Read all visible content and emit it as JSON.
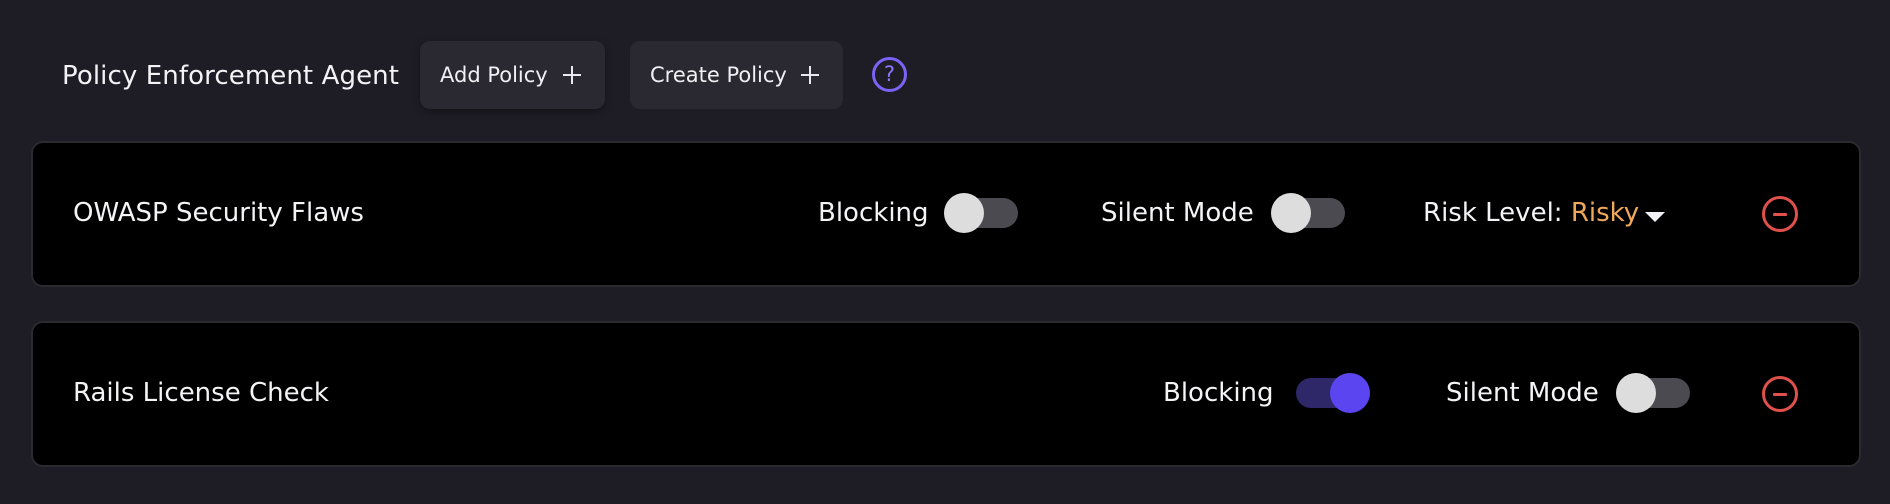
{
  "header": {
    "title": "Policy Enforcement Agent",
    "add_policy_label": "Add Policy",
    "create_policy_label": "Create Policy",
    "help_icon": "?"
  },
  "policies": [
    {
      "name": "OWASP Security Flaws",
      "blocking_label": "Blocking",
      "blocking_enabled": false,
      "silent_label": "Silent Mode",
      "silent_enabled": false,
      "risk_label": "Risk Level:",
      "risk_value": "Risky"
    },
    {
      "name": "Rails License Check",
      "blocking_label": "Blocking",
      "blocking_enabled": true,
      "silent_label": "Silent Mode",
      "silent_enabled": false
    }
  ],
  "colors": {
    "background": "#1e1d26",
    "card": "#000000",
    "accent": "#5b45f0",
    "risk_value": "#f0a85a",
    "remove": "#e0504c"
  },
  "icons": {
    "add": "plus-icon",
    "help": "help-icon",
    "remove": "minus-circle-icon",
    "dropdown": "caret-down-icon"
  }
}
